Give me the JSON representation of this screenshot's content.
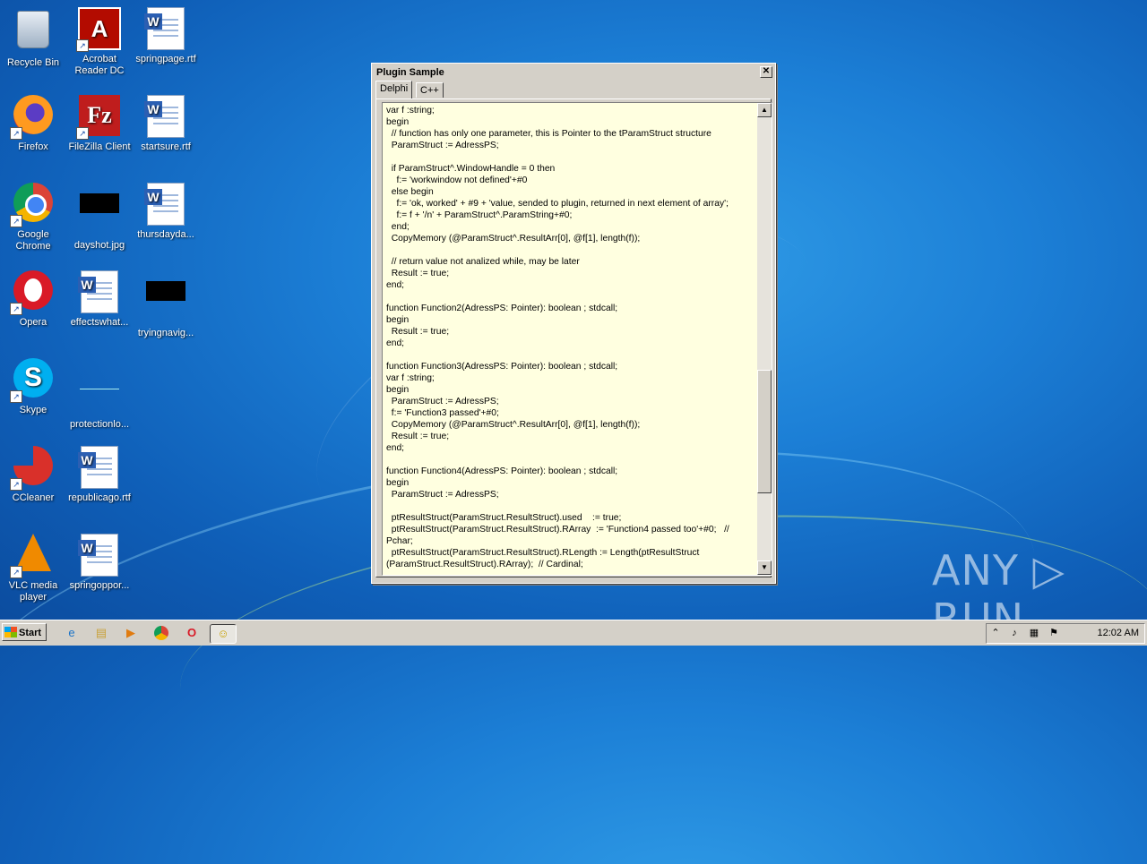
{
  "desktop": {
    "icons": [
      {
        "label": "Recycle Bin"
      },
      {
        "label": "Acrobat Reader DC"
      },
      {
        "label": "springpage.rtf"
      },
      {
        "label": "Firefox"
      },
      {
        "label": "FileZilla Client"
      },
      {
        "label": "startsure.rtf"
      },
      {
        "label": "Google Chrome"
      },
      {
        "label": "dayshot.jpg"
      },
      {
        "label": "thursdayda..."
      },
      {
        "label": "Opera"
      },
      {
        "label": "effectswhat..."
      },
      {
        "label": "tryingnavig..."
      },
      {
        "label": "Skype"
      },
      {
        "label": "protectionlo..."
      },
      {
        "label": "CCleaner"
      },
      {
        "label": "republicago.rtf"
      },
      {
        "label": "VLC media player"
      },
      {
        "label": "springoppor..."
      }
    ]
  },
  "window": {
    "title": "Plugin Sample",
    "close_glyph": "✕",
    "tabs": [
      {
        "label": "Delphi",
        "active": true
      },
      {
        "label": "C++",
        "active": false
      }
    ],
    "code": "var f :string;\nbegin\n  // function has only one parameter, this is Pointer to the tParamStruct structure\n  ParamStruct := AdressPS;\n\n  if ParamStruct^.WindowHandle = 0 then\n    f:= 'workwindow not defined'+#0\n  else begin\n    f:= 'ok, worked' + #9 + 'value, sended to plugin, returned in next element of array';\n    f:= f + '/n' + ParamStruct^.ParamString+#0;\n  end;\n  CopyMemory (@ParamStruct^.ResultArr[0], @f[1], length(f));\n\n  // return value not analized while, may be later\n  Result := true;\nend;\n\nfunction Function2(AdressPS: Pointer): boolean ; stdcall;\nbegin\n  Result := true;\nend;\n\nfunction Function3(AdressPS: Pointer): boolean ; stdcall;\nvar f :string;\nbegin\n  ParamStruct := AdressPS;\n  f:= 'Function3 passed'+#0;\n  CopyMemory (@ParamStruct^.ResultArr[0], @f[1], length(f));\n  Result := true;\nend;\n\nfunction Function4(AdressPS: Pointer): boolean ; stdcall;\nbegin\n  ParamStruct := AdressPS;\n\n  ptResultStruct(ParamStruct.ResultStruct).used    := true;\n  ptResultStruct(ParamStruct.ResultStruct).RArray  := 'Function4 passed too'+#0;   //\nPchar;\n  ptResultStruct(ParamStruct.ResultStruct).RLength := Length(ptResultStruct\n(ParamStruct.ResultStruct).RArray);  // Cardinal;",
    "scroll_up": "▲",
    "scroll_down": "▼"
  },
  "taskbar": {
    "start_label": "Start",
    "clock": "12:02 AM",
    "tray_chevron": "⌃"
  },
  "watermark": "ANY ▷ RUN"
}
